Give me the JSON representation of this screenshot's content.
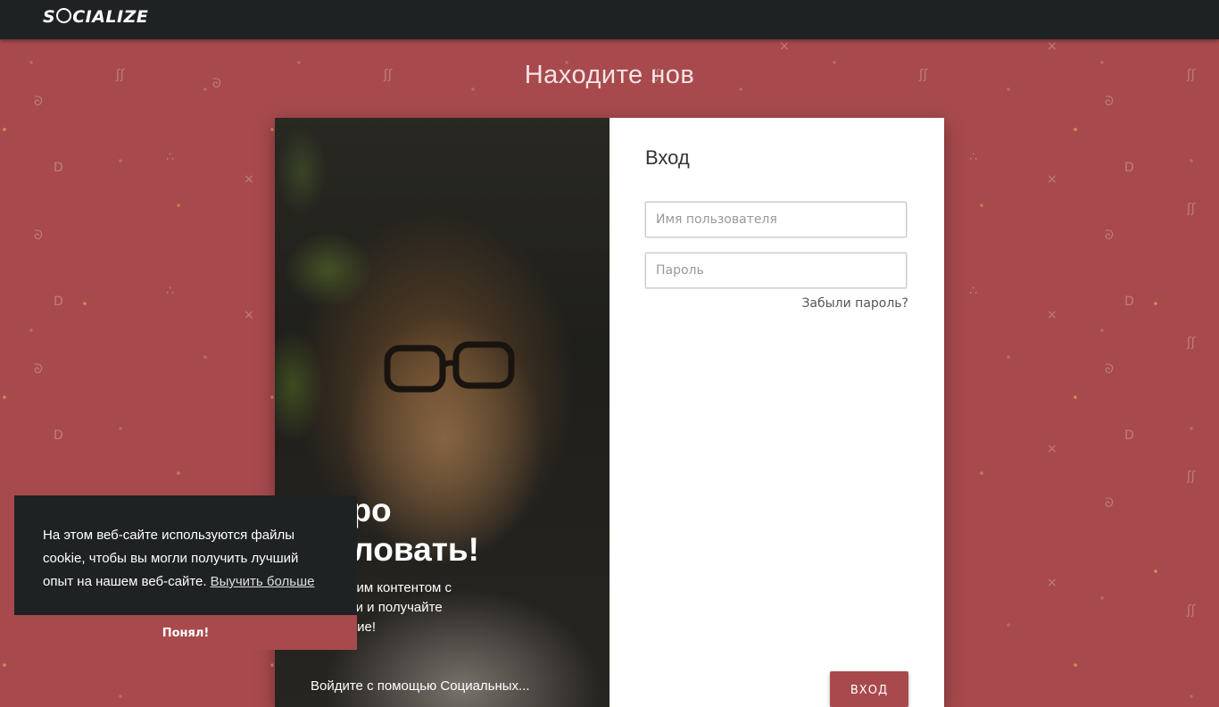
{
  "brand": {
    "logo_text_prefix": "S",
    "logo_text_suffix": "CIALIZE"
  },
  "colors": {
    "accent": "#a84a4d",
    "topbar": "#1f2223",
    "cookie_bg": "#1f2223",
    "panel_bg": "#ffffff"
  },
  "hero": {
    "headline": "Находите нов"
  },
  "photo_panel": {
    "welcome": "обро\nжаловать!",
    "subtitle": "есь своим контентом с\nающими и получайте\nраждение!",
    "bottom_text": "Войдите с помощью Социальных..."
  },
  "login": {
    "title": "Вход",
    "username_placeholder": "Имя пользователя",
    "password_placeholder": "Пароль",
    "forgot_label": "Забыли пароль?",
    "submit_label": "ВХОД"
  },
  "cookie_banner": {
    "message": "На этом веб-сайте используются файлы cookie, чтобы вы могли получить лучший опыт на нашем веб-сайте.",
    "learn_more": "Выучить больше",
    "accept_label": "Понял!"
  }
}
